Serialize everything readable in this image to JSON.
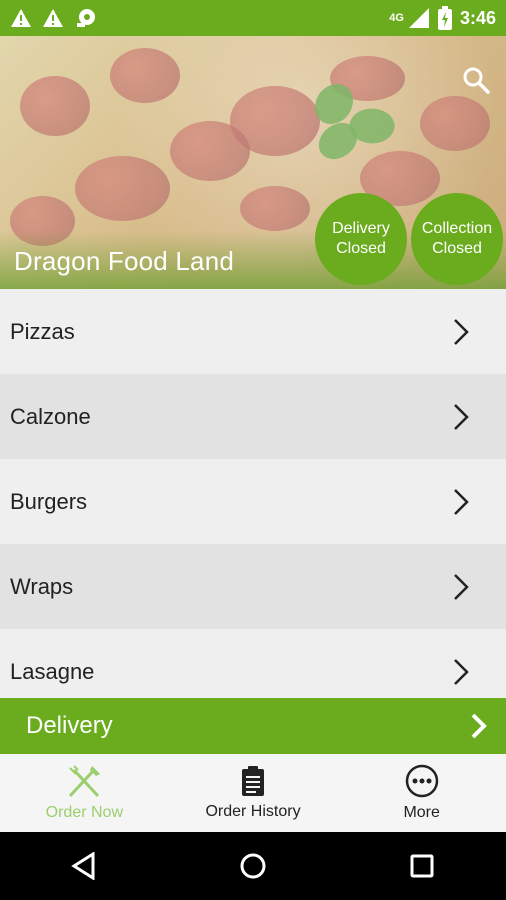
{
  "status_bar": {
    "network": "4G",
    "time": "3:46"
  },
  "hero": {
    "restaurant_name": "Dragon Food Land",
    "badges": [
      {
        "line1": "Delivery",
        "line2": "Closed"
      },
      {
        "line1": "Collection",
        "line2": "Closed"
      }
    ]
  },
  "menu": {
    "items": [
      {
        "label": "Pizzas"
      },
      {
        "label": "Calzone"
      },
      {
        "label": "Burgers"
      },
      {
        "label": "Wraps"
      },
      {
        "label": "Lasagne"
      }
    ]
  },
  "order_bar": {
    "label": "Delivery"
  },
  "tabs": [
    {
      "label": "Order Now",
      "icon": "fork-knife-icon",
      "active": true
    },
    {
      "label": "Order History",
      "icon": "clipboard-icon",
      "active": false
    },
    {
      "label": "More",
      "icon": "more-dots-icon",
      "active": false
    }
  ],
  "colors": {
    "brand_green": "#6aac1e",
    "active_tab": "#9bcf6d",
    "row_alt": "#e2e2e2",
    "row_normal": "#efefef"
  }
}
